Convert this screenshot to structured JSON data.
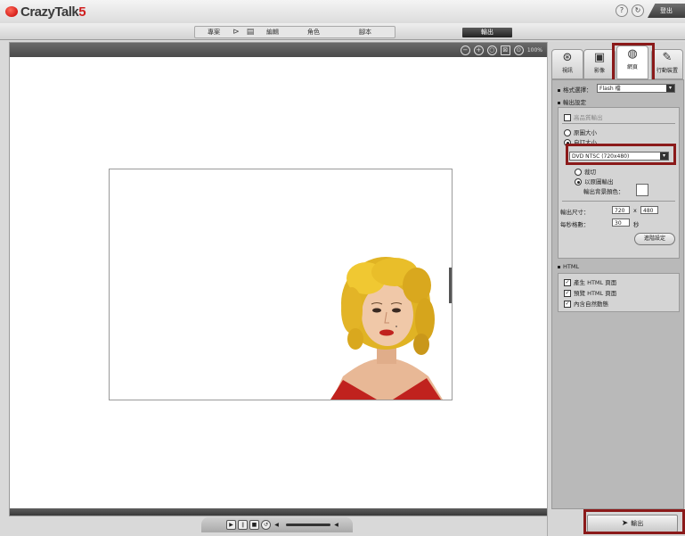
{
  "app": {
    "brand_main": "CrazyTalk",
    "brand_num": "5",
    "help_icon": "?",
    "user_label": "登出"
  },
  "menu": {
    "items": [
      "專案",
      "編輯",
      "角色",
      "腳本"
    ],
    "export_label": "輸出"
  },
  "stage": {
    "zoom_label": "100%"
  },
  "panel": {
    "tabs": [
      {
        "label": "視訊",
        "icon": "film-reel-icon"
      },
      {
        "label": "影像",
        "icon": "image-icon"
      },
      {
        "label": "網頁",
        "icon": "globe-web-icon"
      },
      {
        "label": "行動裝置",
        "icon": "mobile-device-icon"
      }
    ],
    "format_label": "格式選擇：",
    "format_value": "Flash 檔",
    "output_settings_label": "輸出設定",
    "hd_checkbox_label": "高品質輸出",
    "radio_original": "原圖大小",
    "radio_custom": "自訂大小",
    "size_preset": "DVD NTSC (720x480)",
    "crop_label": "裁切",
    "fit_label": "以原圖輸出",
    "bg_color_label": "輸出背景顏色：",
    "output_size_label": "輸出尺寸：",
    "width_value": "720",
    "x_sep": "x",
    "height_value": "480",
    "fps_label": "每秒格數：",
    "fps_value": "30",
    "fps_unit": "秒",
    "advanced_button": "進階設定",
    "html_section": "HTML",
    "html_opts": [
      "產生 HTML 頁面",
      "預覽 HTML 頁面",
      "內含自然動態"
    ],
    "export_button": "輸出"
  },
  "colors": {
    "highlight": "#8b1a1a",
    "brand_red": "#d02020"
  }
}
